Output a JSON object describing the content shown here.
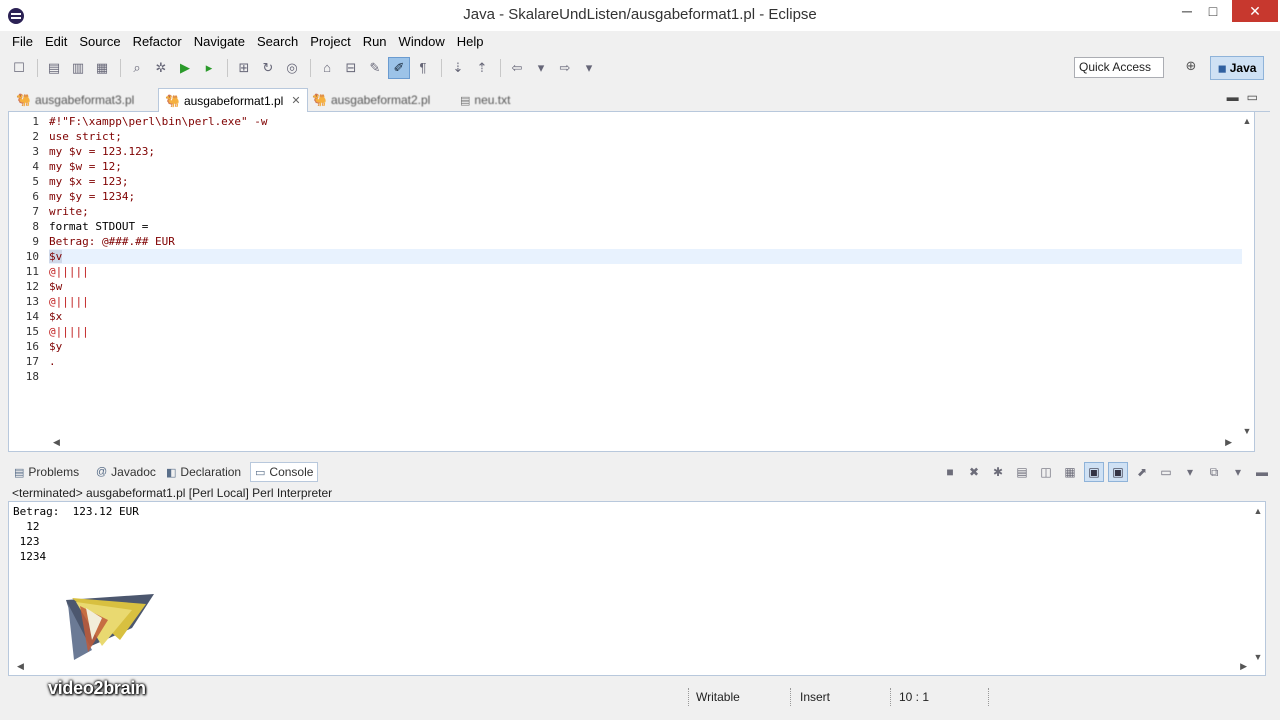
{
  "window": {
    "title": "Java - SkalareUndListen/ausgabeformat1.pl - Eclipse",
    "min_glyph": "─",
    "max_glyph": "□",
    "close_glyph": "✕"
  },
  "menu": [
    "File",
    "Edit",
    "Source",
    "Refactor",
    "Navigate",
    "Search",
    "Project",
    "Run",
    "Window",
    "Help"
  ],
  "toolbar": {
    "quick_access": "Quick Access",
    "perspective_label": "Java"
  },
  "editor_tabs": [
    {
      "label": "ausgabeformat3.pl",
      "icon": "camel-icon"
    },
    {
      "label": "ausgabeformat1.pl",
      "icon": "camel-icon",
      "active": true
    },
    {
      "label": "ausgabeformat2.pl",
      "icon": "camel-icon"
    },
    {
      "label": "neu.txt",
      "icon": "text-file-icon"
    }
  ],
  "editor": {
    "line_numbers": [
      "1",
      "2",
      "3",
      "4",
      "5",
      "6",
      "7",
      "8",
      "9",
      "10",
      "11",
      "12",
      "13",
      "14",
      "15",
      "16",
      "17",
      "18"
    ],
    "lines": {
      "l1": "#!\"F:\\xampp\\perl\\bin\\perl.exe\" -w",
      "l2": "use strict;",
      "l3": "my $v = 123.123;",
      "l4": "my $w = 12;",
      "l5": "my $x = 123;",
      "l6": "my $y = 1234;",
      "l7": "write;",
      "l8": "format STDOUT =",
      "l9": "Betrag: @###.## EUR",
      "l10": "$v",
      "l11": "@|||||",
      "l12": "$w",
      "l13": "@|||||",
      "l14": "$x",
      "l15": "@|||||",
      "l16": "$y",
      "l17": ".",
      "l18": ""
    },
    "current_line": 10
  },
  "panel": {
    "tabs": [
      {
        "label": "Problems",
        "icon": "problems-icon"
      },
      {
        "label": "Javadoc",
        "icon": "at-icon"
      },
      {
        "label": "Declaration",
        "icon": "declaration-icon"
      },
      {
        "label": "Console",
        "icon": "console-icon",
        "active": true
      }
    ],
    "console_status": "<terminated> ausgabeformat1.pl [Perl Local] Perl Interpreter",
    "console_output": [
      "Betrag:  123.12 EUR",
      "  12",
      " 123",
      " 1234"
    ]
  },
  "statusbar": {
    "writable": "Writable",
    "insert_mode": "Insert",
    "position": "10 : 1"
  },
  "logo": {
    "wordmark": "video2brain"
  },
  "colors": {
    "keyword": "#7f0000",
    "format_picture": "#c02020",
    "active_perspective": "#cfe1f4",
    "close_button": "#c7382e"
  }
}
